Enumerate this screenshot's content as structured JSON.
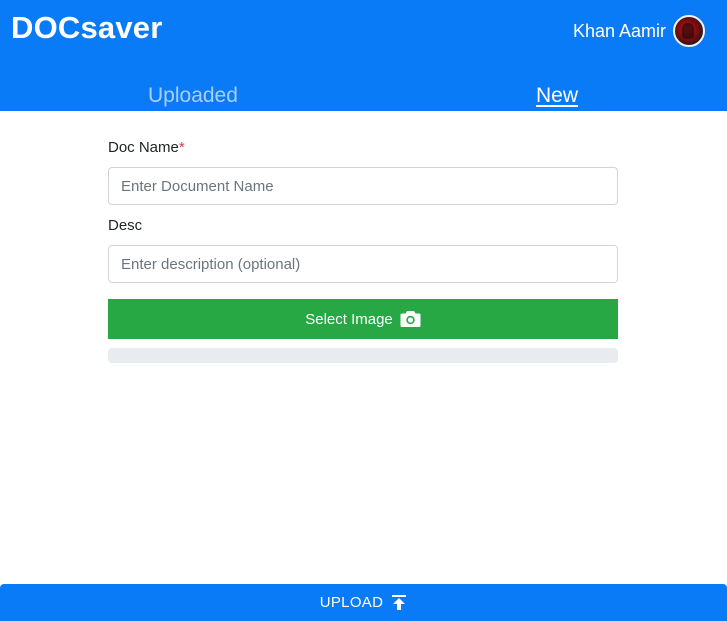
{
  "header": {
    "brand": "DOCsaver",
    "user_name": "Khan Aamir",
    "tabs": [
      {
        "label": "Uploaded",
        "active": false
      },
      {
        "label": "New",
        "active": true
      }
    ]
  },
  "form": {
    "doc_name_label": "Doc Name",
    "required_mark": "*",
    "doc_name_placeholder": "Enter Document Name",
    "doc_name_value": "",
    "desc_label": "Desc",
    "desc_placeholder": "Enter description (optional)",
    "desc_value": "",
    "select_image_label": "Select Image",
    "progress_fraction": 0
  },
  "footer": {
    "upload_label": "UPLOAD"
  },
  "icons": {
    "select_image": "camera-icon",
    "upload": "upload-arrow-icon"
  },
  "colors": {
    "primary": "#0a7bf7",
    "success": "#28a745",
    "required": "#dc3545"
  }
}
